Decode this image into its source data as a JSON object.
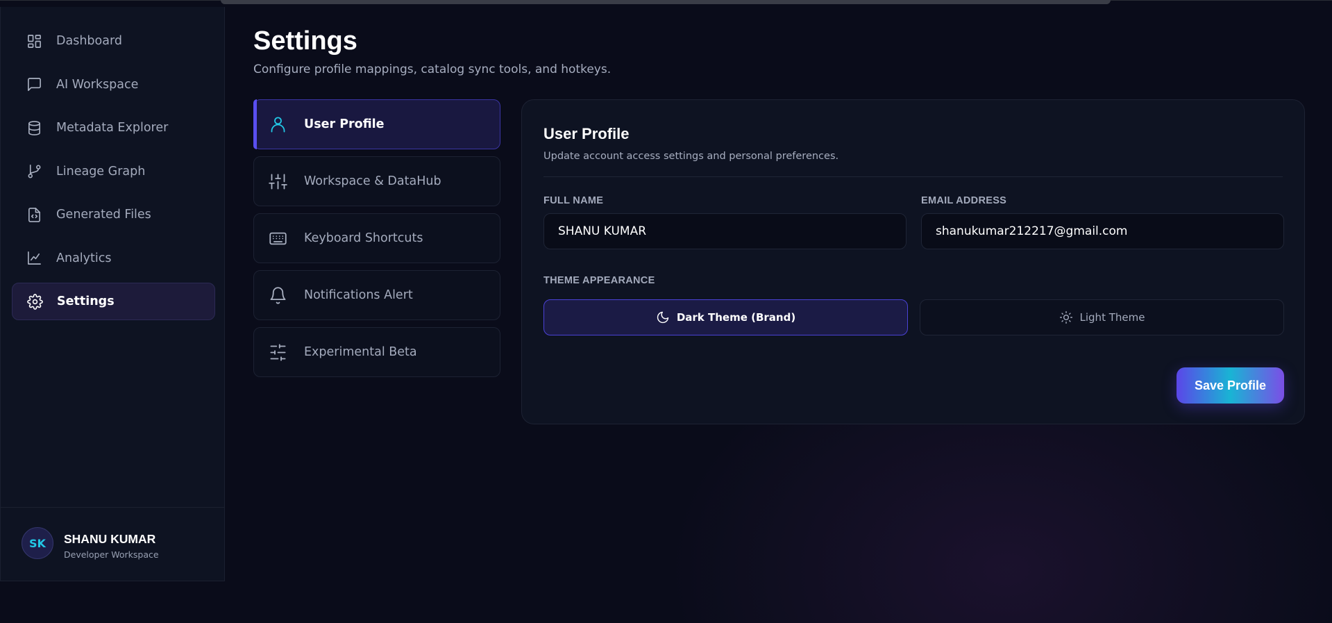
{
  "sidebar": {
    "items": [
      {
        "label": "Dashboard",
        "icon": "dashboard-icon"
      },
      {
        "label": "AI Workspace",
        "icon": "chat-icon"
      },
      {
        "label": "Metadata Explorer",
        "icon": "database-icon"
      },
      {
        "label": "Lineage Graph",
        "icon": "git-branch-icon"
      },
      {
        "label": "Generated Files",
        "icon": "file-code-icon"
      },
      {
        "label": "Analytics",
        "icon": "line-chart-icon"
      },
      {
        "label": "Settings",
        "icon": "gear-icon",
        "active": true
      }
    ],
    "user": {
      "initials": "SK",
      "name": "SHANU KUMAR",
      "subtitle": "Developer Workspace"
    }
  },
  "header": {
    "title": "Settings",
    "subtitle": "Configure profile mappings, catalog sync tools, and hotkeys."
  },
  "tabs": [
    {
      "label": "User Profile",
      "icon": "user-icon",
      "active": true
    },
    {
      "label": "Workspace & DataHub",
      "icon": "sliders-vertical-icon"
    },
    {
      "label": "Keyboard Shortcuts",
      "icon": "keyboard-icon"
    },
    {
      "label": "Notifications Alert",
      "icon": "bell-icon"
    },
    {
      "label": "Experimental Beta",
      "icon": "sliders-horizontal-icon"
    }
  ],
  "panel": {
    "title": "User Profile",
    "subtitle": "Update account access settings and personal preferences.",
    "full_name_label": "FULL NAME",
    "full_name_value": "SHANU KUMAR",
    "email_label": "EMAIL ADDRESS",
    "email_value": "shanukumar212217@gmail.com",
    "theme_label": "THEME APPEARANCE",
    "theme_dark_label": "Dark Theme (Brand)",
    "theme_light_label": "Light Theme",
    "selected_theme": "dark",
    "save_label": "Save Profile"
  },
  "colors": {
    "background": "#0a0c1a",
    "accent": "#5a4ff0",
    "cyan": "#22c8e6"
  }
}
